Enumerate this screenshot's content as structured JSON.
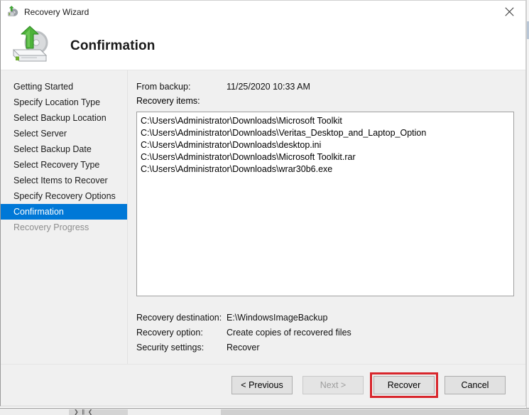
{
  "window": {
    "title": "Recovery Wizard",
    "title_icon": "recovery-wizard-icon",
    "close_icon": "close-icon"
  },
  "header": {
    "icon": "backup-drive-restore-icon",
    "title": "Confirmation"
  },
  "sidebar": {
    "items": [
      {
        "label": "Getting Started",
        "state": "normal"
      },
      {
        "label": "Specify Location Type",
        "state": "normal"
      },
      {
        "label": "Select Backup Location",
        "state": "normal"
      },
      {
        "label": "Select Server",
        "state": "normal"
      },
      {
        "label": "Select Backup Date",
        "state": "normal"
      },
      {
        "label": "Select Recovery Type",
        "state": "normal"
      },
      {
        "label": "Select Items to Recover",
        "state": "normal"
      },
      {
        "label": "Specify Recovery Options",
        "state": "normal"
      },
      {
        "label": "Confirmation",
        "state": "active"
      },
      {
        "label": "Recovery Progress",
        "state": "disabled"
      }
    ],
    "active_color": "#0078d7"
  },
  "content": {
    "from_backup_label": "From backup:",
    "from_backup_value": "11/25/2020 10:33 AM",
    "recovery_items_label": "Recovery items:",
    "recovery_items": [
      "C:\\Users\\Administrator\\Downloads\\Microsoft Toolkit",
      "C:\\Users\\Administrator\\Downloads\\Veritas_Desktop_and_Laptop_Option",
      "C:\\Users\\Administrator\\Downloads\\desktop.ini",
      "C:\\Users\\Administrator\\Downloads\\Microsoft Toolkit.rar",
      "C:\\Users\\Administrator\\Downloads\\wrar30b6.exe"
    ],
    "summary": [
      {
        "label": "Recovery destination:",
        "value": "E:\\WindowsImageBackup"
      },
      {
        "label": "Recovery option:",
        "value": "Create copies of recovered files"
      },
      {
        "label": "Security settings:",
        "value": "Recover"
      }
    ]
  },
  "footer": {
    "previous_label": "< Previous",
    "next_label": "Next >",
    "recover_label": "Recover",
    "cancel_label": "Cancel",
    "highlight_color": "#d8262c"
  },
  "background": {
    "scroll_arrows": "❯ ǁ ❮"
  }
}
